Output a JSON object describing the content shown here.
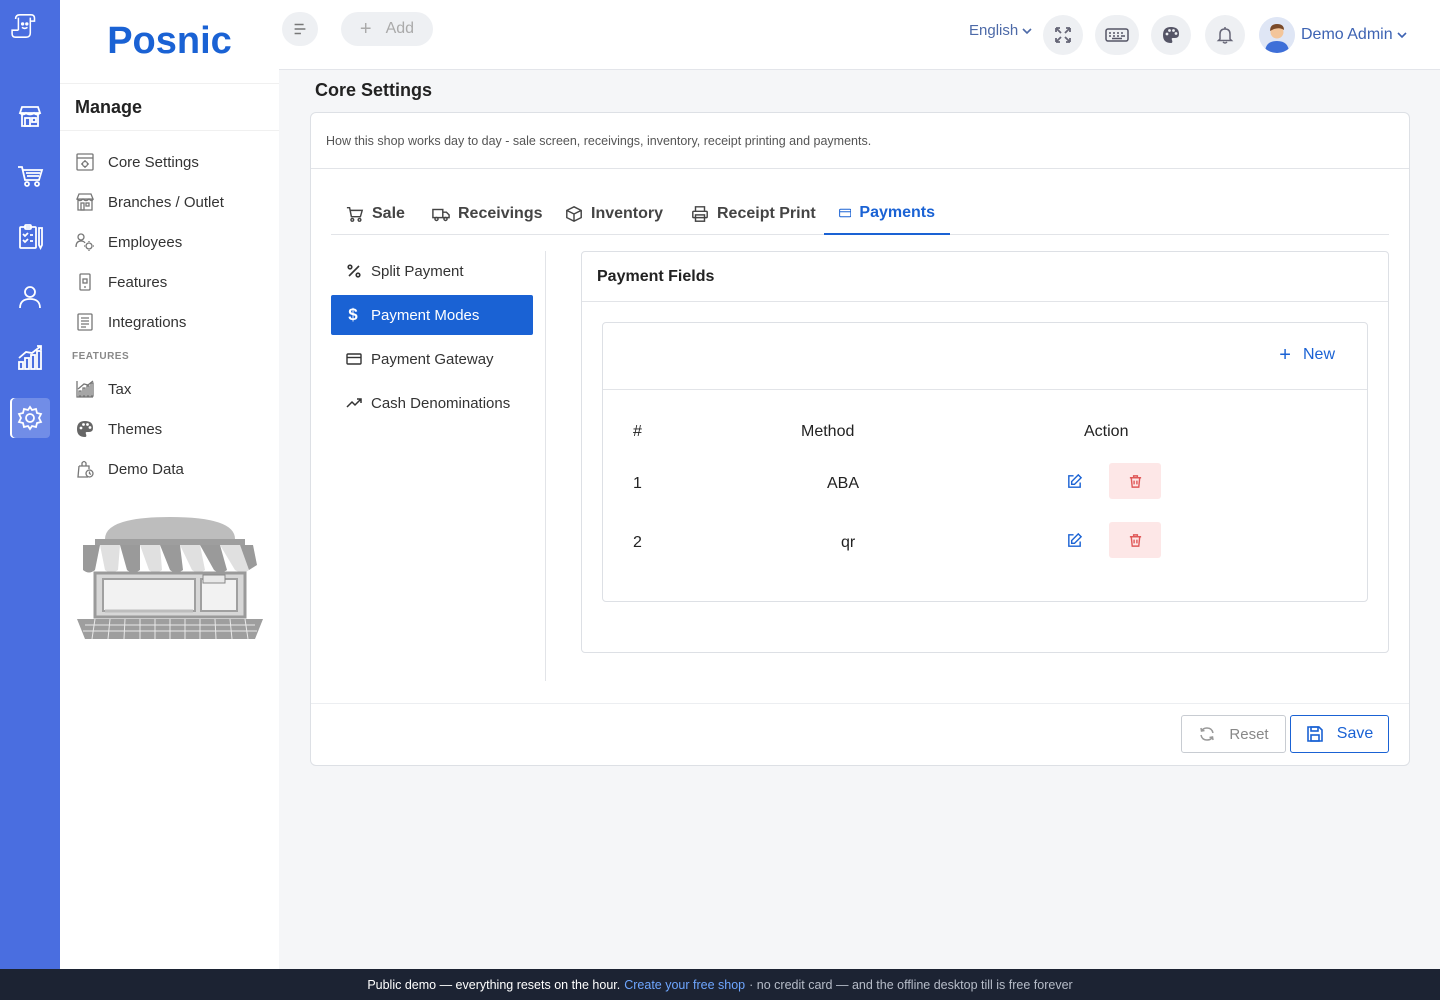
{
  "app": {
    "brand": "Posnic"
  },
  "rail": {
    "items": [
      "store-icon",
      "cart-icon",
      "checklist-icon",
      "user-icon",
      "chart-icon",
      "settings-icon"
    ],
    "active": "settings-icon"
  },
  "sidebar": {
    "heading": "Manage",
    "items": [
      {
        "label": "Core Settings",
        "icon": "settings-box-icon"
      },
      {
        "label": "Branches / Outlet",
        "icon": "branch-icon"
      },
      {
        "label": "Employees",
        "icon": "employees-icon"
      },
      {
        "label": "Features",
        "icon": "features-icon"
      }
    ],
    "integrations": "Integrations",
    "section_label": "FEATURES",
    "feature_items": [
      {
        "label": "Tax",
        "icon": "tax-icon"
      },
      {
        "label": "Themes",
        "icon": "palette-icon"
      },
      {
        "label": "Demo Data",
        "icon": "demo-data-icon"
      }
    ]
  },
  "topbar": {
    "add_label": "Add",
    "language": "English",
    "user_name": "Demo Admin"
  },
  "page": {
    "title": "Core Settings",
    "description": "How this shop works day to day - sale screen, receivings, inventory, receipt printing and payments."
  },
  "tabs": [
    {
      "label": "Sale"
    },
    {
      "label": "Receivings"
    },
    {
      "label": "Inventory"
    },
    {
      "label": "Receipt Print"
    },
    {
      "label": "Payments"
    }
  ],
  "active_tab": "Payments",
  "subnav": [
    {
      "label": "Split Payment"
    },
    {
      "label": "Payment Modes"
    },
    {
      "label": "Payment Gateway"
    },
    {
      "label": "Cash Denominations"
    }
  ],
  "active_subnav": "Payment Modes",
  "payment_fields": {
    "heading": "Payment Fields",
    "new_label": "New",
    "columns": [
      "#",
      "Method",
      "Action"
    ],
    "rows": [
      {
        "index": "1",
        "method": "ABA"
      },
      {
        "index": "2",
        "method": "qr"
      }
    ]
  },
  "buttons": {
    "reset": "Reset",
    "save": "Save"
  },
  "footer": {
    "text_a": "Public demo — everything resets on the hour.",
    "link": "Create your free shop",
    "text_b": "· no credit card — and the offline desktop till is free forever"
  },
  "colors": {
    "primary": "#1a62d4",
    "rail": "#4a6ee0",
    "danger_bg": "#fde7e7",
    "danger": "#e05858",
    "footer_bg": "#1c2333"
  }
}
